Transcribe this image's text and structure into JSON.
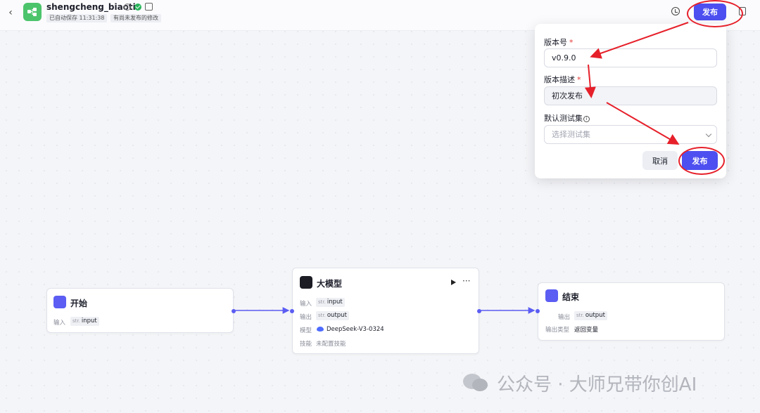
{
  "header": {
    "back_label": "‹",
    "app_title": "shengcheng_biaoti",
    "saved_status": "已自动保存 11:31:38",
    "unpublished_status": "有尚未发布的修改",
    "publish_label": "发布"
  },
  "publish_popover": {
    "version_label": "版本号",
    "version_value": "v0.9.0",
    "description_label": "版本描述",
    "description_value": "初次发布",
    "testset_label": "默认测试集",
    "testset_placeholder": "选择测试集",
    "cancel_label": "取消",
    "confirm_label": "发布"
  },
  "nodes": {
    "start": {
      "title": "开始",
      "input_label": "输入",
      "input_type": "str.",
      "input_name": "input"
    },
    "llm": {
      "title": "大模型",
      "input_label": "输入",
      "input_type": "str.",
      "input_name": "input",
      "output_label": "输出",
      "output_type": "str.",
      "output_name": "output",
      "model_label": "模型",
      "model_value": "DeepSeek-V3-0324",
      "skill_label": "技能",
      "skill_value": "未配置技能"
    },
    "end": {
      "title": "结束",
      "output_label": "输出",
      "output_type": "str.",
      "output_name": "output",
      "output_type_label": "输出类型",
      "output_type_value": "返回变量"
    }
  },
  "watermark": "公众号 · 大师兄带你创AI",
  "colors": {
    "primary": "#4d4ff0",
    "annotation_red": "#e6202a",
    "app_logo_green": "#4cc46c"
  }
}
